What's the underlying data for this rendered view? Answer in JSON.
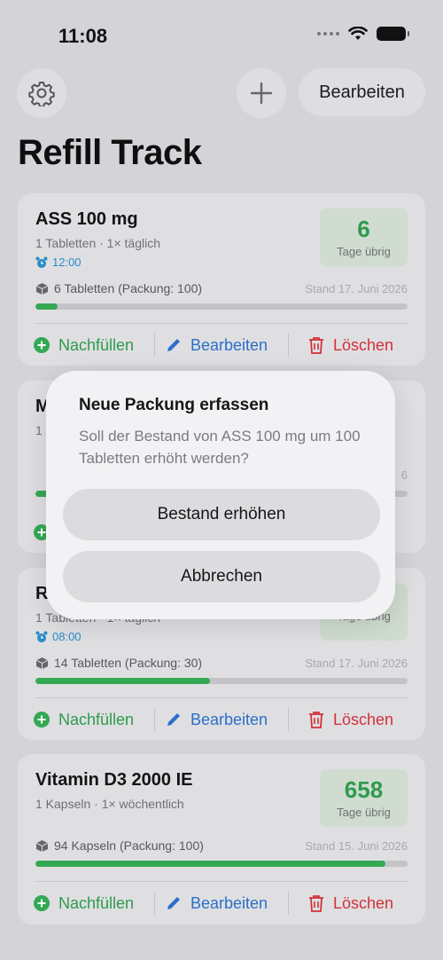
{
  "status": {
    "time": "11:08"
  },
  "toolbar": {
    "edit_label": "Bearbeiten"
  },
  "app_title": "Refill Track",
  "medications": [
    {
      "name": "ASS 100 mg",
      "dose": "1 Tabletten · 1× täglich",
      "alarm": "12:00",
      "days_left": "6",
      "days_label": "Tage übrig",
      "stock": "6 Tabletten (Packung: 100)",
      "stand": "Stand 17. Juni 2026",
      "fill_fraction": 0.06
    },
    {
      "name": "M",
      "dose": "1",
      "days_left": "",
      "stand": "6",
      "fill_fraction": 0.15
    },
    {
      "name": "R",
      "dose": "1 Tabletten · 1× täglich",
      "alarm": "08:00",
      "days_left": "",
      "days_label": "Tage übrig",
      "stock": "14 Tabletten (Packung: 30)",
      "stand": "Stand 17. Juni 2026",
      "fill_fraction": 0.47
    },
    {
      "name": "Vitamin D3 2000 IE",
      "dose": "1 Kapseln · 1× wöchentlich",
      "days_left": "658",
      "days_label": "Tage übrig",
      "stock": "94 Kapseln (Packung: 100)",
      "stand": "Stand 15. Juni 2026",
      "fill_fraction": 0.94
    }
  ],
  "actions": {
    "refill": "Nachfüllen",
    "edit": "Bearbeiten",
    "delete": "Löschen"
  },
  "dialog": {
    "title": "Neue Packung erfassen",
    "message": "Soll der Bestand von ASS 100 mg um 100 Tabletten erhöht werden?",
    "confirm": "Bestand erhöhen",
    "cancel": "Abbrechen"
  },
  "colors": {
    "green": "#34a853",
    "blue": "#2b6fc8",
    "red": "#d2303a",
    "alarm": "#2a8cc7"
  }
}
